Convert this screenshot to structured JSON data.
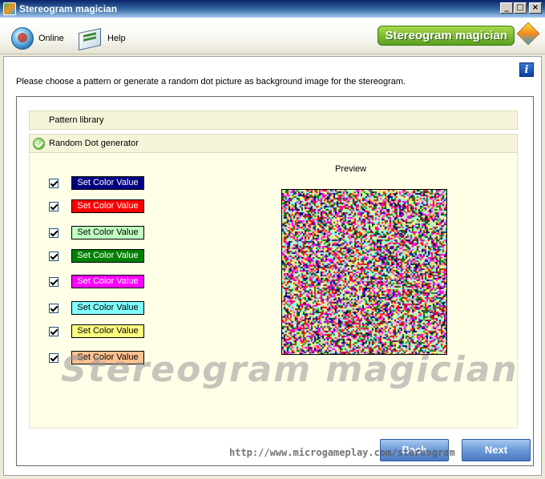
{
  "window": {
    "title": "Stereogram magician",
    "controls": {
      "minimize": "_",
      "maximize": "□",
      "close": "×"
    }
  },
  "toolbar": {
    "online_label": "Online",
    "help_label": "Help",
    "brand": "Stereogram magician",
    "icons": {
      "online": "globe-icon",
      "help": "book-icon",
      "brand": "cube-icon"
    }
  },
  "info_button": "i",
  "instruction": "Please choose a pattern or generate a random dot picture as background image for the stereogram.",
  "accordion": {
    "pattern_library": "Pattern library",
    "random_dot": "Random Dot generator"
  },
  "colors": [
    {
      "label": "Set Color Value",
      "bg": "#000080",
      "fg": "#ffffff",
      "checked": true
    },
    {
      "label": "Set Color Value",
      "bg": "#ff0000",
      "fg": "#ffffff",
      "checked": true
    },
    {
      "label": "Set Color Value",
      "bg": "#c0ffc0",
      "fg": "#000000",
      "checked": true
    },
    {
      "label": "Set Color Value",
      "bg": "#008000",
      "fg": "#ffffff",
      "checked": true
    },
    {
      "label": "Set Color Value",
      "bg": "#ff00ff",
      "fg": "#ffffff",
      "checked": true
    },
    {
      "label": "Set Color Value",
      "bg": "#80ffff",
      "fg": "#000000",
      "checked": true
    },
    {
      "label": "Set Color Value",
      "bg": "#ffff80",
      "fg": "#000000",
      "checked": true
    },
    {
      "label": "Set Color Value",
      "bg": "#ffc090",
      "fg": "#000000",
      "checked": true
    }
  ],
  "preview_label": "Preview",
  "watermark": "Stereogram magician",
  "buttons": {
    "back": "Back",
    "next": "Next"
  },
  "url": "http://www.microgameplay.com/stereogram"
}
